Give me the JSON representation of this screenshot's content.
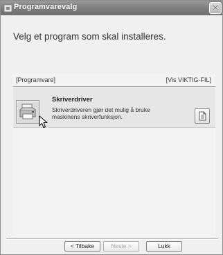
{
  "window": {
    "title": "Programvarevalg"
  },
  "instruction": "Velg et program som skal installeres.",
  "list": {
    "header_left": "[Programvare]",
    "header_right": "[Vis VIKTIG-FIL]",
    "items": [
      {
        "title": "Skriverdriver",
        "description": "Skriverdriveren gjør det mulig å bruke maskinens skriverfunksjon.",
        "icon": "printer-icon"
      }
    ]
  },
  "buttons": {
    "back": "< Tilbake",
    "next": "Neste >",
    "close": "Lukk"
  }
}
